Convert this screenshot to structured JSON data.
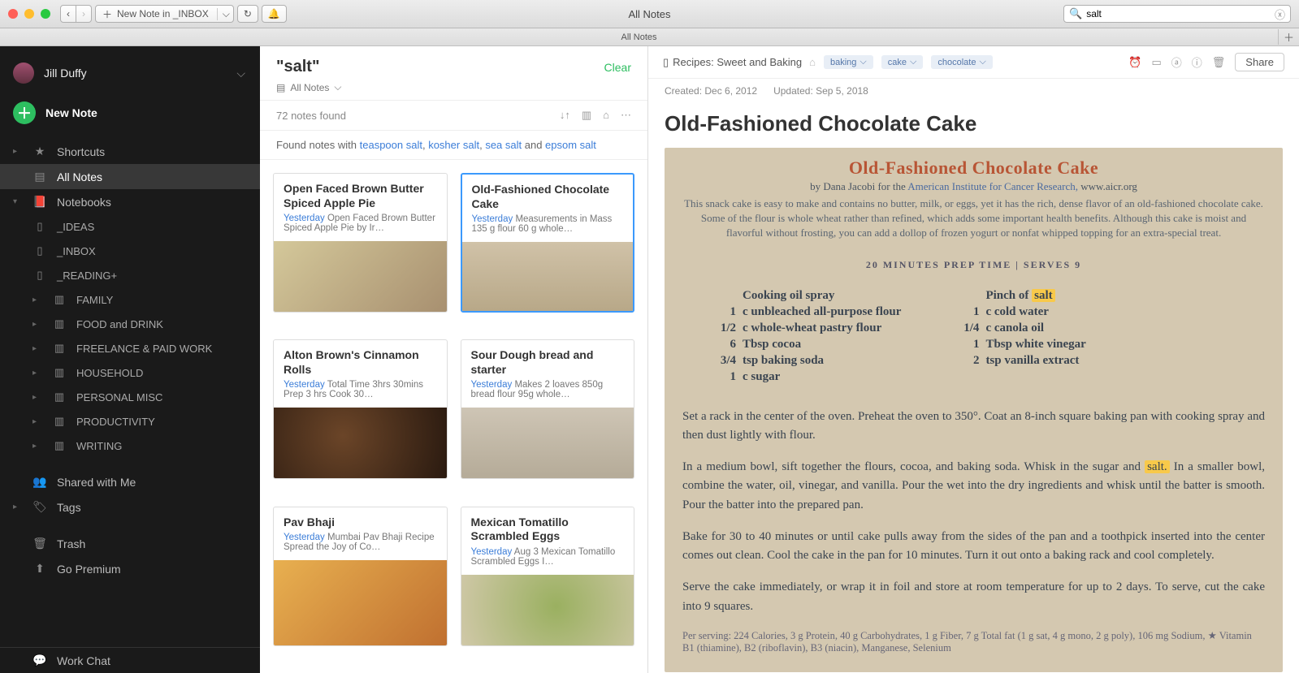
{
  "window_title": "All Notes",
  "toolbar": {
    "new_note_label": "New Note in _INBOX",
    "tab_label": "All Notes"
  },
  "search": {
    "value": "salt"
  },
  "sidebar": {
    "user_name": "Jill Duffy",
    "new_note": "New Note",
    "shortcuts": "Shortcuts",
    "all_notes": "All Notes",
    "notebooks": "Notebooks",
    "shared": "Shared with Me",
    "tags": "Tags",
    "trash": "Trash",
    "premium": "Go Premium",
    "workchat": "Work Chat",
    "items": [
      {
        "label": "_IDEAS"
      },
      {
        "label": "_INBOX"
      },
      {
        "label": "_READING+"
      },
      {
        "label": "FAMILY"
      },
      {
        "label": "FOOD and DRINK"
      },
      {
        "label": "FREELANCE & PAID WORK"
      },
      {
        "label": "HOUSEHOLD"
      },
      {
        "label": "PERSONAL MISC"
      },
      {
        "label": "PRODUCTIVITY"
      },
      {
        "label": "WRITING"
      }
    ]
  },
  "mid": {
    "heading": "\"salt\"",
    "clear": "Clear",
    "scope": "All Notes",
    "count": "72 notes found",
    "found_prefix": "Found notes with ",
    "found_links": [
      "teaspoon salt",
      "kosher salt",
      "sea salt",
      "epsom salt"
    ],
    "and": " and "
  },
  "cards": [
    {
      "title": "Open Faced Brown Butter Spiced Apple Pie",
      "date": "Yesterday",
      "snip": "Open Faced Brown Butter Spiced Apple Pie by Ir…"
    },
    {
      "title": "Old-Fashioned Chocolate Cake",
      "date": "Yesterday",
      "snip": "Measurements in Mass 135 g flour 60 g whole…"
    },
    {
      "title": "Alton Brown's Cinnamon Rolls",
      "date": "Yesterday",
      "snip": "Total Time 3hrs 30mins Prep 3 hrs Cook 30…"
    },
    {
      "title": "Sour Dough bread and starter",
      "date": "Yesterday",
      "snip": "Makes 2 loaves 850g bread flour 95g whole…"
    },
    {
      "title": "Pav Bhaji",
      "date": "Yesterday",
      "snip": "Mumbai Pav Bhaji Recipe Spread the Joy of Co…"
    },
    {
      "title": "Mexican Tomatillo Scrambled Eggs",
      "date": "Yesterday",
      "snip": "Aug 3 Mexican Tomatillo Scrambled Eggs I…"
    }
  ],
  "note": {
    "notebook": "Recipes: Sweet and Baking",
    "tags": [
      "baking",
      "cake",
      "chocolate"
    ],
    "created": "Created: Dec 6, 2012",
    "updated": "Updated: Sep 5, 2018",
    "share": "Share",
    "title": "Old-Fashioned Chocolate Cake"
  },
  "recipe": {
    "title": "Old-Fashioned Chocolate Cake",
    "byline_pre": "by Dana Jacobi for the ",
    "byline_link": "American Institute for Cancer Research,",
    "byline_url": "www.aicr.org",
    "intro": "This snack cake is easy to make and contains no butter, milk, or eggs, yet it has the rich, dense flavor of an old-fashioned chocolate cake. Some of the flour is whole wheat rather than refined, which adds some important health benefits. Although this cake is moist and flavorful without frosting, you can add a dollop of frozen yogurt or nonfat whipped topping for an extra-special treat.",
    "prep": "20 MINUTES PREP TIME  |  SERVES 9",
    "ing_left": [
      {
        "amt": "",
        "name": "Cooking oil spray"
      },
      {
        "amt": "1",
        "name": "c unbleached all-purpose flour"
      },
      {
        "amt": "1/2",
        "name": "c whole-wheat pastry flour"
      },
      {
        "amt": "6",
        "name": "Tbsp cocoa"
      },
      {
        "amt": "3/4",
        "name": "tsp baking soda"
      },
      {
        "amt": "1",
        "name": "c sugar"
      }
    ],
    "ing_right": [
      {
        "amt": "",
        "name_pre": "Pinch of ",
        "name_hl": "salt"
      },
      {
        "amt": "1",
        "name": "c cold water"
      },
      {
        "amt": "1/4",
        "name": "c canola oil"
      },
      {
        "amt": "1",
        "name": "Tbsp white vinegar"
      },
      {
        "amt": "2",
        "name": "tsp vanilla extract"
      }
    ],
    "p1": "Set a rack in the center of the oven. Preheat the oven to 350°. Coat an 8-inch square baking pan with cooking spray and then dust lightly with flour.",
    "p2a": "In a medium bowl, sift together the flours, cocoa, and baking soda. Whisk in the sugar and ",
    "p2hl": "salt.",
    "p2b": " In a smaller bowl, combine the water, oil, vinegar, and vanilla. Pour the wet into the dry ingredients and whisk until the batter is smooth. Pour the batter into the prepared pan.",
    "p3": "Bake for 30 to 40 minutes or until cake pulls away from the sides of the pan and a toothpick inserted into the center comes out clean. Cool the cake in the pan for 10 minutes. Turn it out onto a baking rack and cool completely.",
    "p4": "Serve the cake immediately, or wrap it in foil and store at room temperature for up to 2 days. To serve, cut the cake into 9 squares.",
    "perserv": "Per serving: 224 Calories, 3 g Protein, 40 g Carbohydrates, 1 g Fiber, 7 g Total fat (1 g sat, 4 g mono, 2 g poly), 106 mg Sodium, ★ Vitamin B1 (thiamine), B2 (riboflavin), B3 (niacin), Manganese, Selenium"
  }
}
